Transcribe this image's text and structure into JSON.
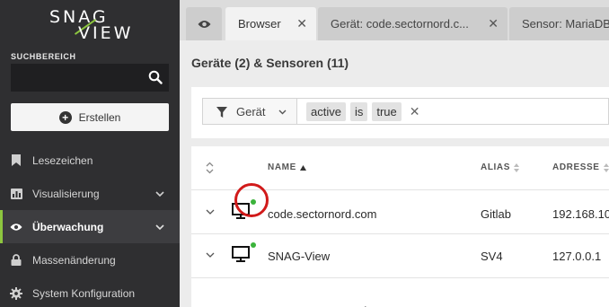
{
  "brand": {
    "logo_line1": "SNAG",
    "logo_line2": "VIEW",
    "accent_color": "#8dc63f"
  },
  "sidebar": {
    "search_label": "SUCHBEREICH",
    "search_value": "",
    "create_label": "Erstellen",
    "items": [
      {
        "label": "Lesezeichen",
        "icon": "bookmark-icon",
        "has_chevron": false,
        "active": false
      },
      {
        "label": "Visualisierung",
        "icon": "bar-chart-icon",
        "has_chevron": true,
        "active": false
      },
      {
        "label": "Überwachung",
        "icon": "eye-icon",
        "has_chevron": true,
        "active": true
      },
      {
        "label": "Massenänderung",
        "icon": "lock-icon",
        "has_chevron": false,
        "active": false
      },
      {
        "label": "System Konfiguration",
        "icon": "gear-icon",
        "has_chevron": false,
        "active": false
      }
    ]
  },
  "tabs": [
    {
      "label": "",
      "icon": "eye-icon"
    },
    {
      "label": "Browser",
      "active": true
    },
    {
      "label": "Gerät: code.sectornord.c..."
    },
    {
      "label": "Sensor: MariaDB"
    }
  ],
  "page_title": "Geräte (2) & Sensoren (11)",
  "filter": {
    "type_label": "Gerät",
    "chips": [
      "active",
      "is",
      "true"
    ]
  },
  "table": {
    "columns": [
      "NAME",
      "ALIAS",
      "ADRESSE"
    ],
    "sorted_column": "NAME",
    "rows": [
      {
        "name": "code.sectornord.com",
        "alias": "Gitlab",
        "address": "192.168.10",
        "status": "online"
      },
      {
        "name": "SNAG-View",
        "alias": "SV4",
        "address": "127.0.0.1",
        "status": "online"
      }
    ]
  },
  "colors": {
    "status_online": "#3bb33b",
    "highlight": "#d11a1a",
    "sidebar_bg": "#2f2f31"
  }
}
